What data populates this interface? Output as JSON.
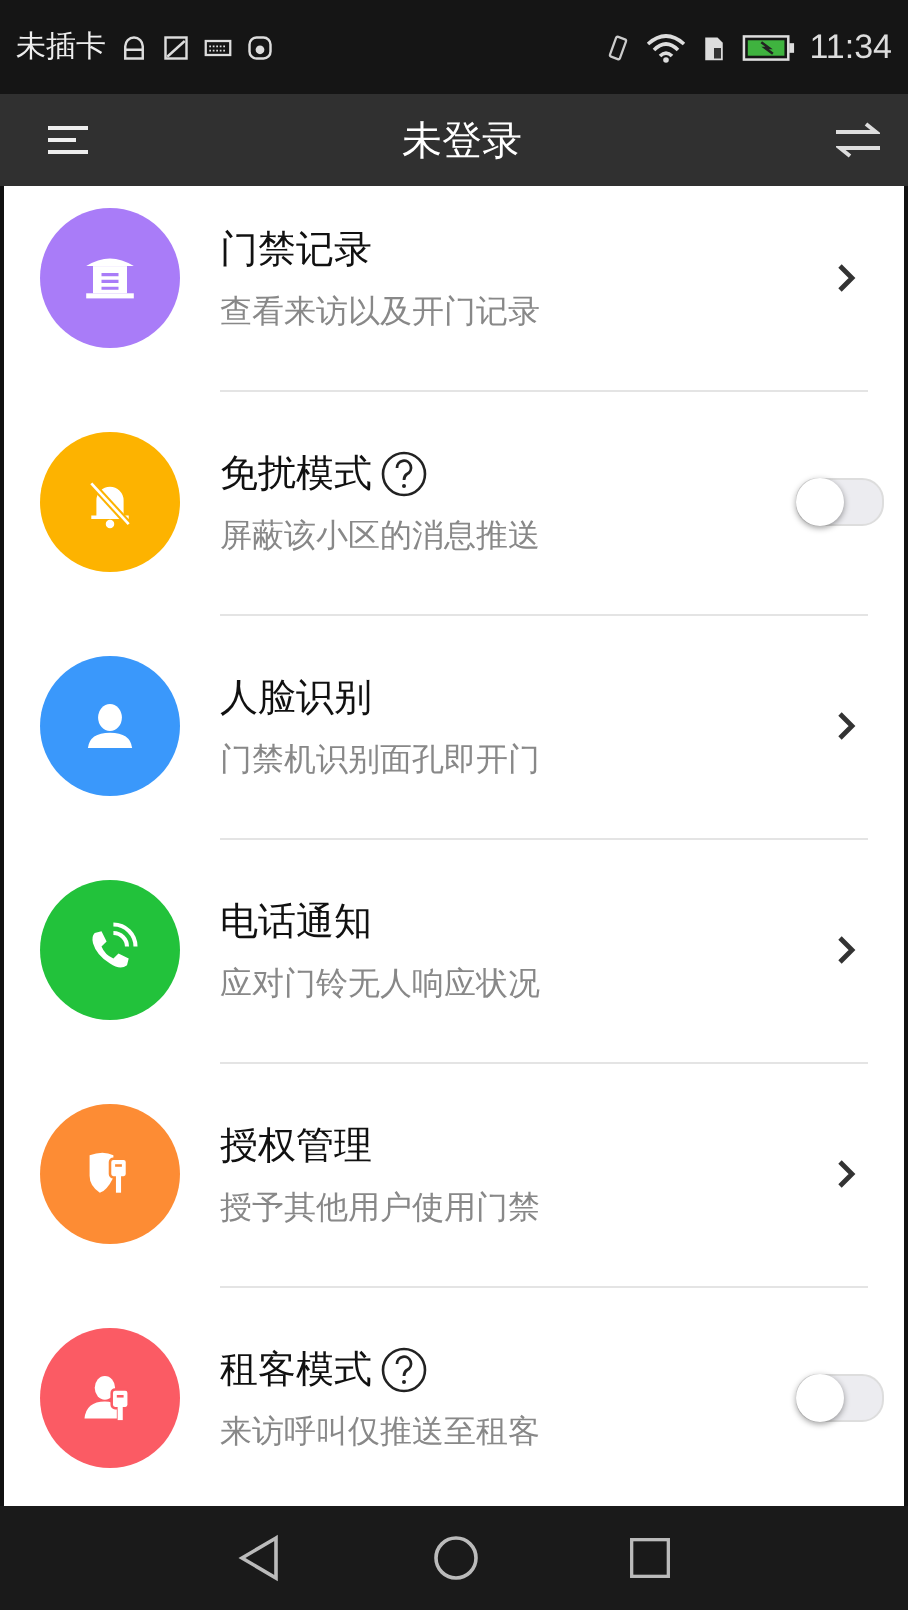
{
  "status_bar": {
    "carrier": "未插卡",
    "time": "11:34"
  },
  "header": {
    "title": "未登录"
  },
  "items": [
    {
      "kind": "link",
      "title": "门禁记录",
      "subtitle": "查看来访以及开门记录",
      "color": "#a97cf8",
      "help": false
    },
    {
      "kind": "toggle",
      "title": "免扰模式",
      "subtitle": "屏蔽该小区的消息推送",
      "color": "#fdb300",
      "help": true,
      "on": false
    },
    {
      "kind": "link",
      "title": "人脸识别",
      "subtitle": "门禁机识别面孔即开门",
      "color": "#3a98fb",
      "help": false
    },
    {
      "kind": "link",
      "title": "电话通知",
      "subtitle": "应对门铃无人响应状况",
      "color": "#22c23b",
      "help": false
    },
    {
      "kind": "link",
      "title": "授权管理",
      "subtitle": "授予其他用户使用门禁",
      "color": "#fd8c34",
      "help": false
    },
    {
      "kind": "toggle",
      "title": "租客模式",
      "subtitle": "来访呼叫仅推送至租客",
      "color": "#fb5b64",
      "help": true,
      "on": false
    }
  ]
}
